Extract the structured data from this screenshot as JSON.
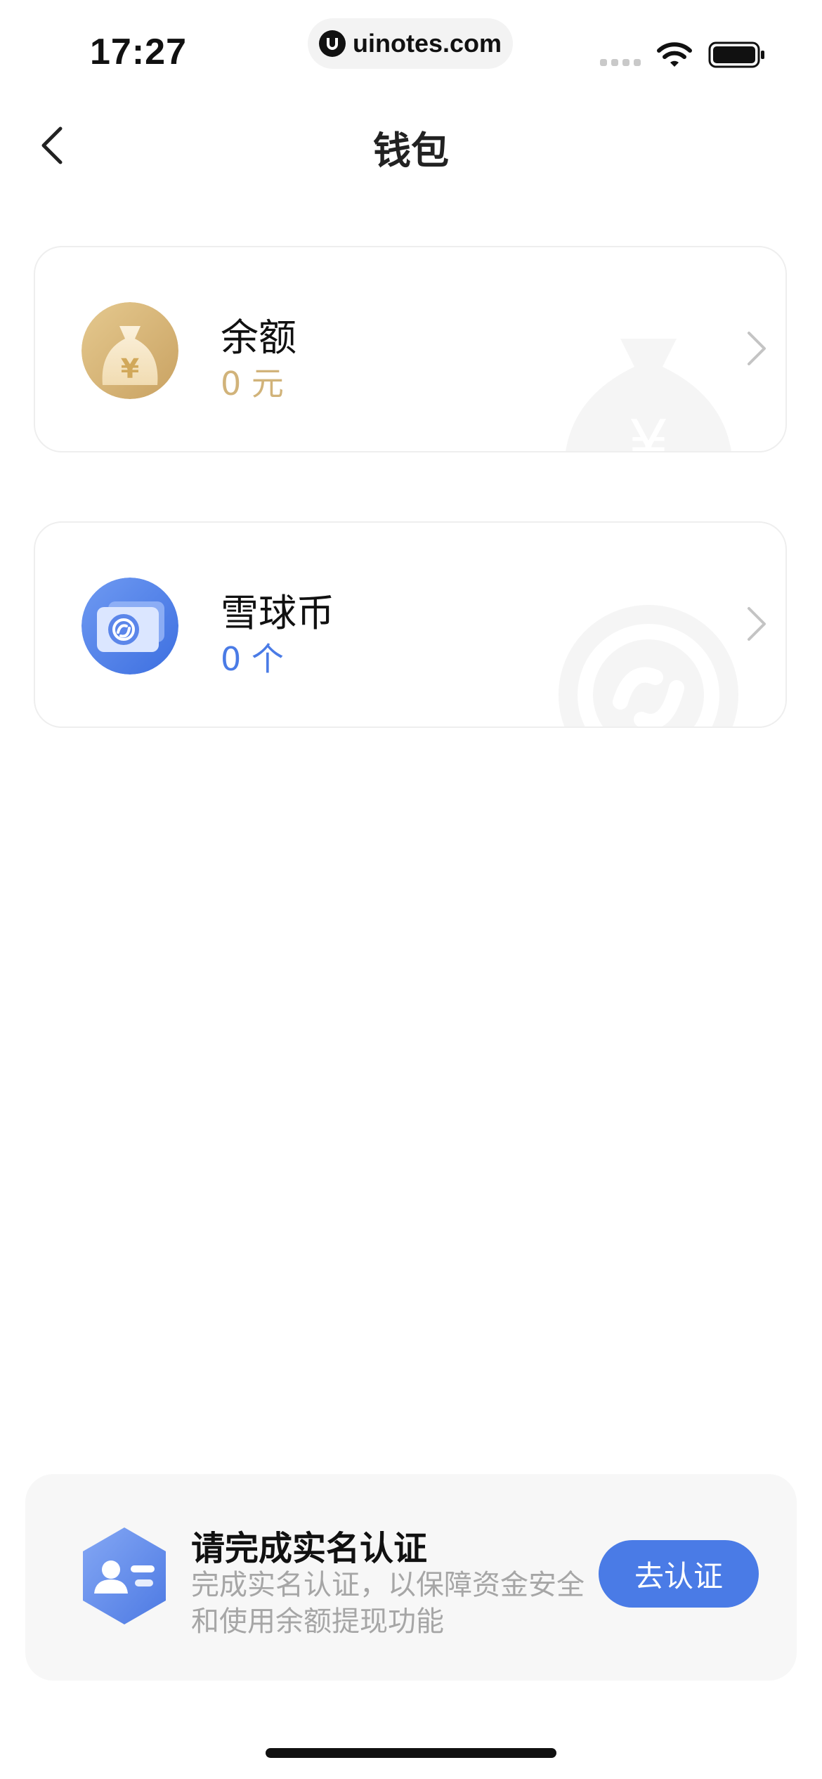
{
  "status_bar": {
    "time": "17:27",
    "url": "uinotes.com"
  },
  "nav": {
    "back_icon": "chevron-left-icon",
    "title": "钱包"
  },
  "cards": {
    "balance": {
      "title": "余额",
      "value": "0 元",
      "icon": "money-bag-icon",
      "accent": "#d1b37a"
    },
    "coin": {
      "title": "雪球币",
      "value": "0 个",
      "icon": "snowball-coin-icon",
      "accent": "#4a7be6"
    }
  },
  "verify": {
    "title": "请完成实名认证",
    "description": "完成实名认证，以保障资金安全和使用余额提现功能",
    "button_label": "去认证",
    "icon": "id-card-icon",
    "accent": "#4a7be6"
  }
}
